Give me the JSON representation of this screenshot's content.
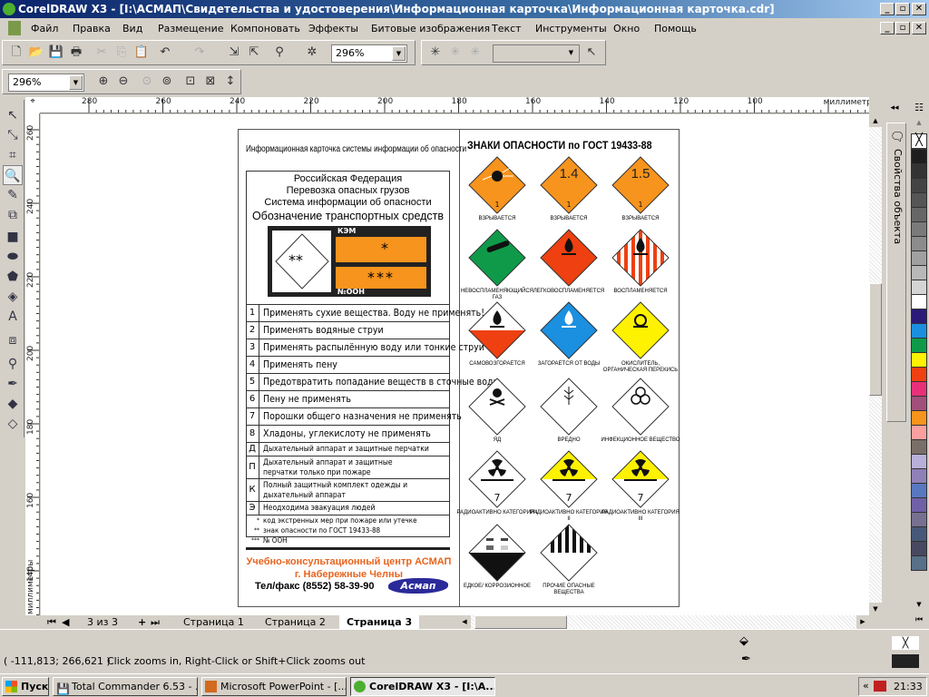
{
  "window": {
    "title": "CorelDRAW X3 - [I:\\АСМАП\\Свидетельства и удостоверения\\Информационная карточка\\Информационная карточка.cdr]"
  },
  "menu": [
    "Файл",
    "Правка",
    "Вид",
    "Размещение",
    "Компоновать",
    "Эффекты",
    "Битовые изображения",
    "Текст",
    "Инструменты",
    "Окно",
    "Помощь"
  ],
  "toolbar": {
    "zoom_value": "296%",
    "zoom_value2": "296%"
  },
  "ruler": {
    "unit": "миллиметры",
    "h_labels": [
      "280",
      "260",
      "240",
      "220",
      "200",
      "180",
      "160",
      "140",
      "120",
      "100"
    ],
    "v_labels": [
      "260",
      "240",
      "220",
      "200",
      "180",
      "160",
      "140"
    ],
    "v_unit": "миллиметры"
  },
  "docker": {
    "label": "Свойства объекта"
  },
  "palette": [
    "#1e1e1e",
    "#333333",
    "#444444",
    "#555555",
    "#666666",
    "#7a7a7a",
    "#8c8c8c",
    "#a0a0a0",
    "#b8b8b8",
    "#d4d4d4",
    "#ffffff",
    "#2b1a78",
    "#1b8fe0",
    "#0f9a4a",
    "#fff200",
    "#ee4010",
    "#e8307a",
    "#a0507a",
    "#f7941d",
    "#f8a0a0",
    "#7a6e68",
    "#b8b0d8",
    "#9080b8",
    "#5878c0",
    "#7060a8",
    "#787090",
    "#485878",
    "#484860",
    "#587088"
  ],
  "card": {
    "header": "Информационная карточка системы информации об опасности",
    "box_lines": [
      "Российская Федерация",
      "Перевозка опасных грузов",
      "Система информации об опасности"
    ],
    "box_title": "Обозначение транспортных средств",
    "plate": {
      "kem": "КЭМ",
      "noon": "№ООН",
      "star1": "*",
      "star2": "**",
      "star3": "***"
    },
    "rows": [
      {
        "n": "1",
        "t": "Применять сухие вещества. Воду не применять!"
      },
      {
        "n": "2",
        "t": "Применять водяные струи"
      },
      {
        "n": "3",
        "t": "Применять распылённую воду или тонкие струи"
      },
      {
        "n": "4",
        "t": "Применять пену"
      },
      {
        "n": "5",
        "t": "Предотвратить попадание веществ в сточные воды"
      },
      {
        "n": "6",
        "t": "Пену не применять"
      },
      {
        "n": "7",
        "t": "Порошки общего назначения не применять"
      },
      {
        "n": "8",
        "t": "Хладоны, углекислоту не применять"
      }
    ],
    "rows2": [
      {
        "n": "Д",
        "t1": "Дыхательный аппарат и защитные перчатки",
        "t2": ""
      },
      {
        "n": "П",
        "t1": "Дыхательный аппарат и защитные",
        "t2": "перчатки только при пожаре"
      },
      {
        "n": "К",
        "t1": "Полный защитный комплект одежды и",
        "t2": "дыхательный аппарат"
      },
      {
        "n": "Э",
        "t1": "Неодходима эвакуация людей",
        "t2": ""
      }
    ],
    "notes": [
      "код экстренных мер при пожаре или утечке",
      "знак опасности по ГОСТ 19433-88",
      "№ ООН"
    ],
    "note_marks": [
      "*",
      "**",
      "***"
    ],
    "org1": "Учебно-консультационный центр АСМАП",
    "org2": "г. Набережные Челны",
    "phone": "Тел/факс (8552) 58-39-90",
    "logo": "Асмап",
    "accent": "#e8641e"
  },
  "signs_title": "ЗНАКИ ОПАСНОСТИ по ГОСТ 19433-88",
  "signs": [
    {
      "label": "ВЗРЫВАЕТСЯ",
      "fill": "#f7941d",
      "sym": "bomb",
      "num": "1"
    },
    {
      "label": "ВЗРЫВАЕТСЯ",
      "fill": "#f7941d",
      "sym": "1.4",
      "num": "1"
    },
    {
      "label": "ВЗРЫВАЕТСЯ",
      "fill": "#f7941d",
      "sym": "1.5",
      "num": "1"
    },
    {
      "label": "НЕВОСПЛАМЕНЯЮЩИЙСЯ ГАЗ",
      "fill": "#0f9a4a",
      "sym": "cylinder",
      "num": ""
    },
    {
      "label": "ЛЕГКОВОСПЛАМЕНЯЕТСЯ",
      "fill": "#ee4010",
      "sym": "flame",
      "num": ""
    },
    {
      "label": "ВОСПЛАМЕНЯЕТСЯ",
      "fill": "stripes",
      "sym": "flame",
      "num": ""
    },
    {
      "label": "САМОВОЗГОРАЕТСЯ",
      "fill": "halfred",
      "sym": "flame",
      "num": ""
    },
    {
      "label": "ЗАГОРАЕТСЯ ОТ ВОДЫ",
      "fill": "#1b8fe0",
      "sym": "flame-white",
      "num": ""
    },
    {
      "label": "ОКИСЛИТЕЛЬ, ОРГАНИЧЕСКАЯ ПЕРЕКИСЬ",
      "fill": "#fff200",
      "sym": "oxidizer",
      "num": ""
    },
    {
      "label": "ЯД",
      "fill": "#ffffff",
      "sym": "skull",
      "num": ""
    },
    {
      "label": "ВРЕДНО",
      "fill": "#ffffff",
      "sym": "wheat",
      "num": ""
    },
    {
      "label": "ИНФЕКЦИОННОЕ ВЕЩЕСТВО",
      "fill": "#ffffff",
      "sym": "biohazard",
      "num": ""
    },
    {
      "label": "РАДИОАКТИВНО КАТЕГОРИЯ I",
      "fill": "#ffffff",
      "sym": "radio",
      "num": "7"
    },
    {
      "label": "РАДИОАКТИВНО КАТЕГОРИЯ II",
      "fill": "halfyellow",
      "sym": "radio",
      "num": "7"
    },
    {
      "label": "РАДИОАКТИВНО КАТЕГОРИЯ III",
      "fill": "halfyellow",
      "sym": "radio",
      "num": "7"
    },
    {
      "label": "ЕДКОЕ/ КОРРОЗИОННОЕ",
      "fill": "halfblack",
      "sym": "corrosive",
      "num": ""
    },
    {
      "label": "ПРОЧИЕ ОПАСНЫЕ ВЕЩЕСТВА",
      "fill": "topstripes",
      "sym": "",
      "num": ""
    }
  ],
  "pages": {
    "counter": "3 из 3",
    "tabs": [
      "Страница 1",
      "Страница 2",
      "Страница 3"
    ],
    "active": "Страница 3"
  },
  "status": {
    "coords": "( -111,813; 266,621 )",
    "hint": "Click zooms in, Right-Click or Shift+Click zooms out"
  },
  "taskbar": {
    "start": "Пуск",
    "tasks": [
      "Total Commander 6.53 - ...",
      "Microsoft PowerPoint - [...",
      "CorelDRAW X3 - [I:\\А..."
    ],
    "clock": "21:33"
  }
}
